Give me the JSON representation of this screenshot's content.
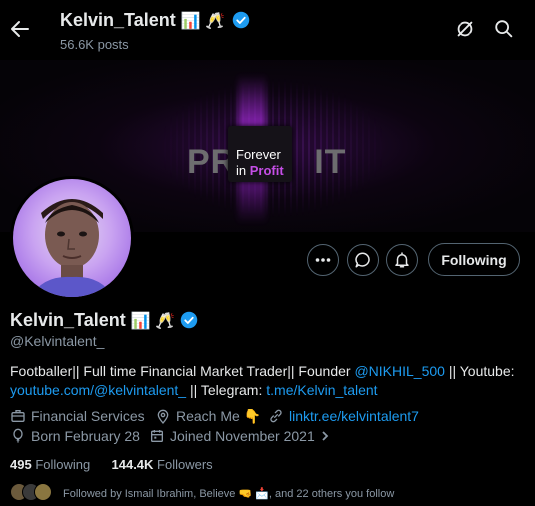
{
  "header": {
    "title": "Kelvin_Talent",
    "title_emoji": "📊 🥂",
    "posts": "56.6K posts"
  },
  "banner": {
    "bg_word_left": "PR",
    "bg_word_right": "IT",
    "line1": "Forever",
    "line2_a": "in ",
    "line2_b": "Profit"
  },
  "actions": {
    "follow_label": "Following"
  },
  "profile": {
    "name": "Kelvin_Talent",
    "name_emoji": "📊 🥂",
    "handle": "@Kelvintalent_",
    "bio_1": "Footballer|| Full time Financial Market Trader|| Founder ",
    "bio_mention": "@NIKHIL_500",
    "bio_2": " || Youtube: ",
    "bio_youtube": "youtube.com/@kelvintalent_",
    "bio_3": " || Telegram: ",
    "bio_telegram": "t.me/Kelvin_talent",
    "category": "Financial Services",
    "location": "Reach Me 👇",
    "website": "linktr.ee/kelvintalent7",
    "born": "Born February 28",
    "joined": "Joined November 2021",
    "following_count": "495",
    "following_label": "Following",
    "followers_count": "144.4K",
    "followers_label": "Followers",
    "followed_by": "Followed by Ismail Ibrahim, Believe 🤜 📩, and 22 others you follow"
  },
  "colors": {
    "accent": "#1d9bf0",
    "verified": "#1d9bf0",
    "profit": "#c54ee6"
  }
}
